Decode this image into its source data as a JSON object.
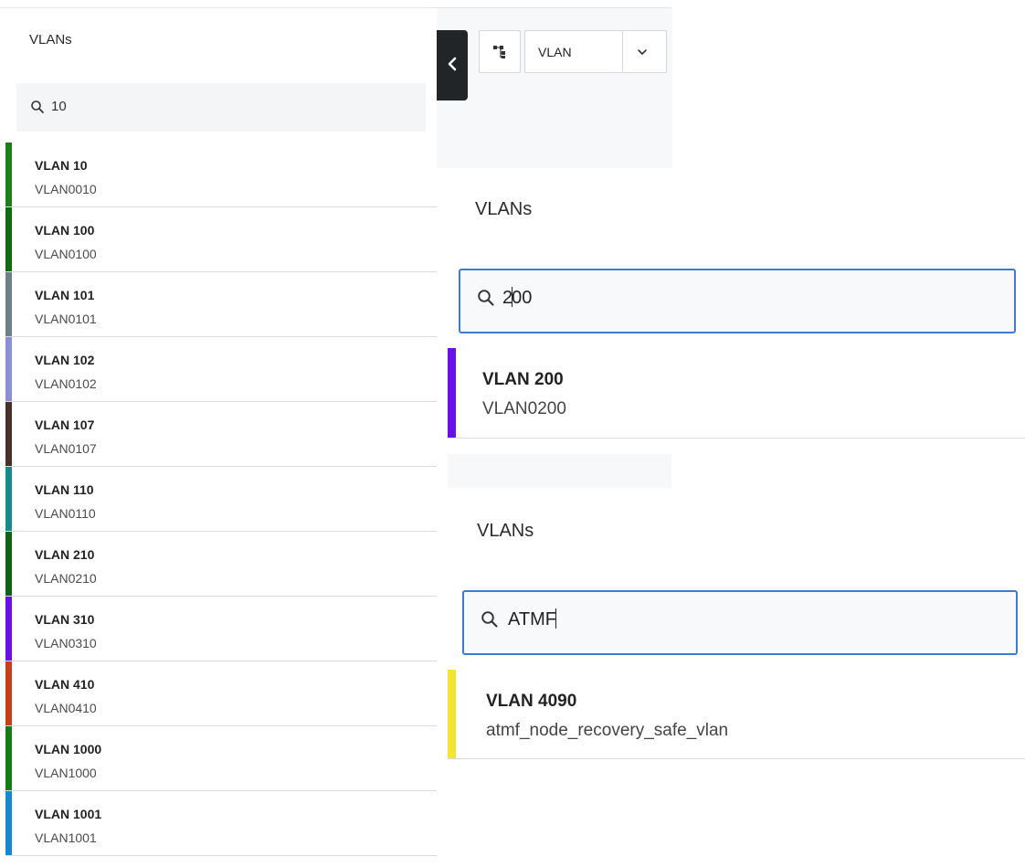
{
  "left_panel": {
    "title": "VLANs",
    "search_value": "10",
    "items": [
      {
        "name": "VLAN 10",
        "sub": "VLAN0010",
        "color": "#1a7f1a"
      },
      {
        "name": "VLAN 100",
        "sub": "VLAN0100",
        "color": "#116a11"
      },
      {
        "name": "VLAN 101",
        "sub": "VLAN0101",
        "color": "#6f7f88"
      },
      {
        "name": "VLAN 102",
        "sub": "VLAN0102",
        "color": "#8c8fd6"
      },
      {
        "name": "VLAN 107",
        "sub": "VLAN0107",
        "color": "#4a2f28"
      },
      {
        "name": "VLAN 110",
        "sub": "VLAN0110",
        "color": "#168a8c"
      },
      {
        "name": "VLAN 210",
        "sub": "VLAN0210",
        "color": "#0f6312"
      },
      {
        "name": "VLAN 310",
        "sub": "VLAN0310",
        "color": "#6a10e6"
      },
      {
        "name": "VLAN 410",
        "sub": "VLAN0410",
        "color": "#c8401a"
      },
      {
        "name": "VLAN 1000",
        "sub": "VLAN1000",
        "color": "#157c15"
      },
      {
        "name": "VLAN 1001",
        "sub": "VLAN1001",
        "color": "#1787d0"
      }
    ]
  },
  "toolbar": {
    "view_select_value": "VLAN"
  },
  "panel_200": {
    "title": "VLANs",
    "search_before_caret": "2",
    "search_after_caret": "00",
    "item": {
      "name": "VLAN 200",
      "sub": "VLAN0200",
      "color": "#6a10e6"
    }
  },
  "panel_atmf": {
    "title": "VLANs",
    "search_before_caret": "ATMF",
    "search_after_caret": "",
    "item": {
      "name": "VLAN 4090",
      "sub": "atmf_node_recovery_safe_vlan",
      "color": "#f2e630"
    }
  }
}
